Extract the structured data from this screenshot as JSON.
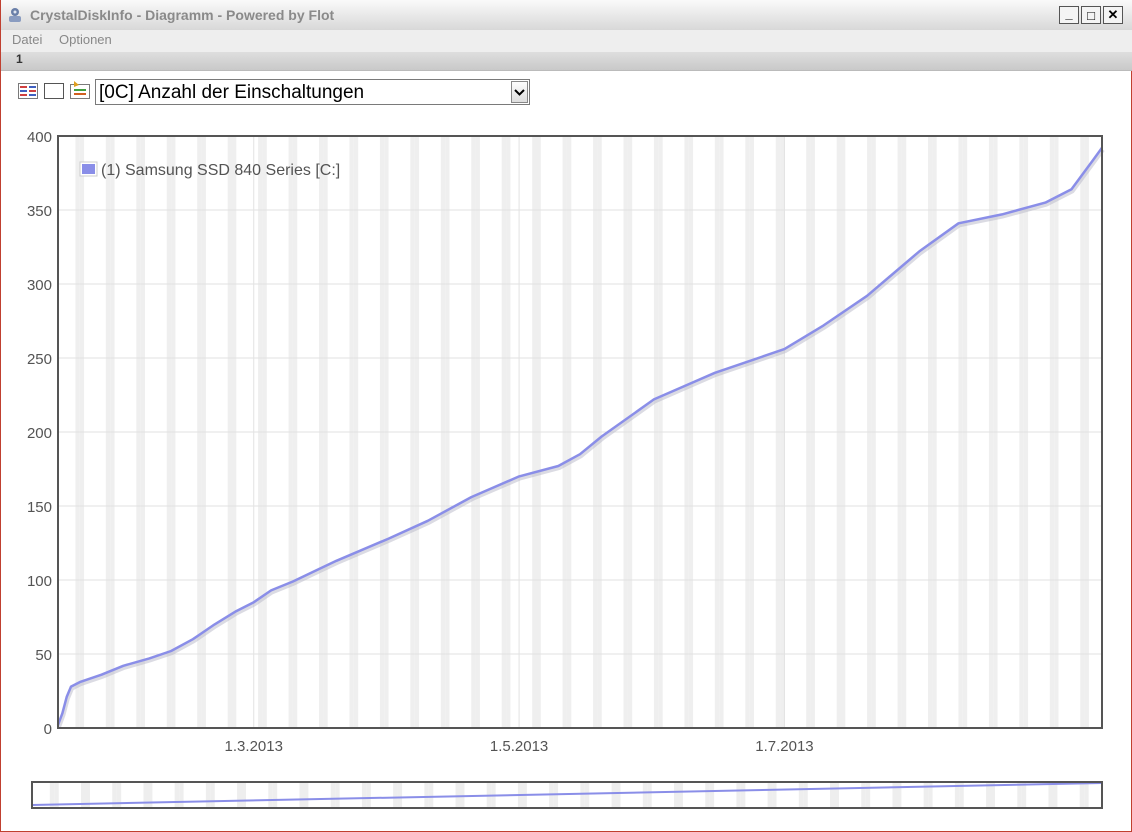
{
  "window": {
    "title": "CrystalDiskInfo - Diagramm - Powered by Flot",
    "minimize_glyph": "_",
    "maximize_glyph": "□",
    "close_glyph": "✕"
  },
  "menu": {
    "items": [
      "Datei",
      "Optionen"
    ]
  },
  "tabs": [
    "1"
  ],
  "toolbar": {
    "icons": [
      "table-view-icon",
      "blank-view-icon",
      "export-icon"
    ],
    "attribute_selected": "[0C] Anzahl der Einschaltungen"
  },
  "colors": {
    "series": "#8a8ee8",
    "accent_border": "#c04030"
  },
  "chart_data": {
    "type": "line",
    "title": "",
    "xlabel": "",
    "ylabel": "",
    "legend": "top-left",
    "grid": true,
    "ylim": [
      0,
      400
    ],
    "xlim": [
      "2013-01-15",
      "2013-09-12"
    ],
    "yticks": [
      0,
      50,
      100,
      150,
      200,
      250,
      300,
      350,
      400
    ],
    "xticks": [
      {
        "date": "2013-03-01",
        "label": "1.3.2013"
      },
      {
        "date": "2013-05-01",
        "label": "1.5.2013"
      },
      {
        "date": "2013-07-01",
        "label": "1.7.2013"
      }
    ],
    "series": [
      {
        "name": "(1) Samsung SSD 840 Series [C:]",
        "x": [
          "2013-01-15",
          "2013-01-16",
          "2013-01-17",
          "2013-01-18",
          "2013-01-20",
          "2013-01-25",
          "2013-01-30",
          "2013-02-05",
          "2013-02-10",
          "2013-02-15",
          "2013-02-20",
          "2013-02-25",
          "2013-03-01",
          "2013-03-05",
          "2013-03-10",
          "2013-03-15",
          "2013-03-20",
          "2013-04-01",
          "2013-04-10",
          "2013-04-20",
          "2013-05-01",
          "2013-05-10",
          "2013-05-15",
          "2013-05-20",
          "2013-06-01",
          "2013-06-15",
          "2013-07-01",
          "2013-07-10",
          "2013-07-20",
          "2013-08-01",
          "2013-08-10",
          "2013-08-20",
          "2013-08-30",
          "2013-09-05",
          "2013-09-10",
          "2013-09-12"
        ],
        "y": [
          2,
          10,
          21,
          28,
          31,
          36,
          42,
          47,
          52,
          60,
          70,
          79,
          85,
          93,
          99,
          106,
          113,
          128,
          140,
          156,
          170,
          177,
          185,
          197,
          222,
          240,
          256,
          272,
          292,
          322,
          341,
          347,
          355,
          364,
          384,
          392
        ]
      }
    ]
  },
  "overview_data": {
    "y_start": 2,
    "y_end": 392
  }
}
